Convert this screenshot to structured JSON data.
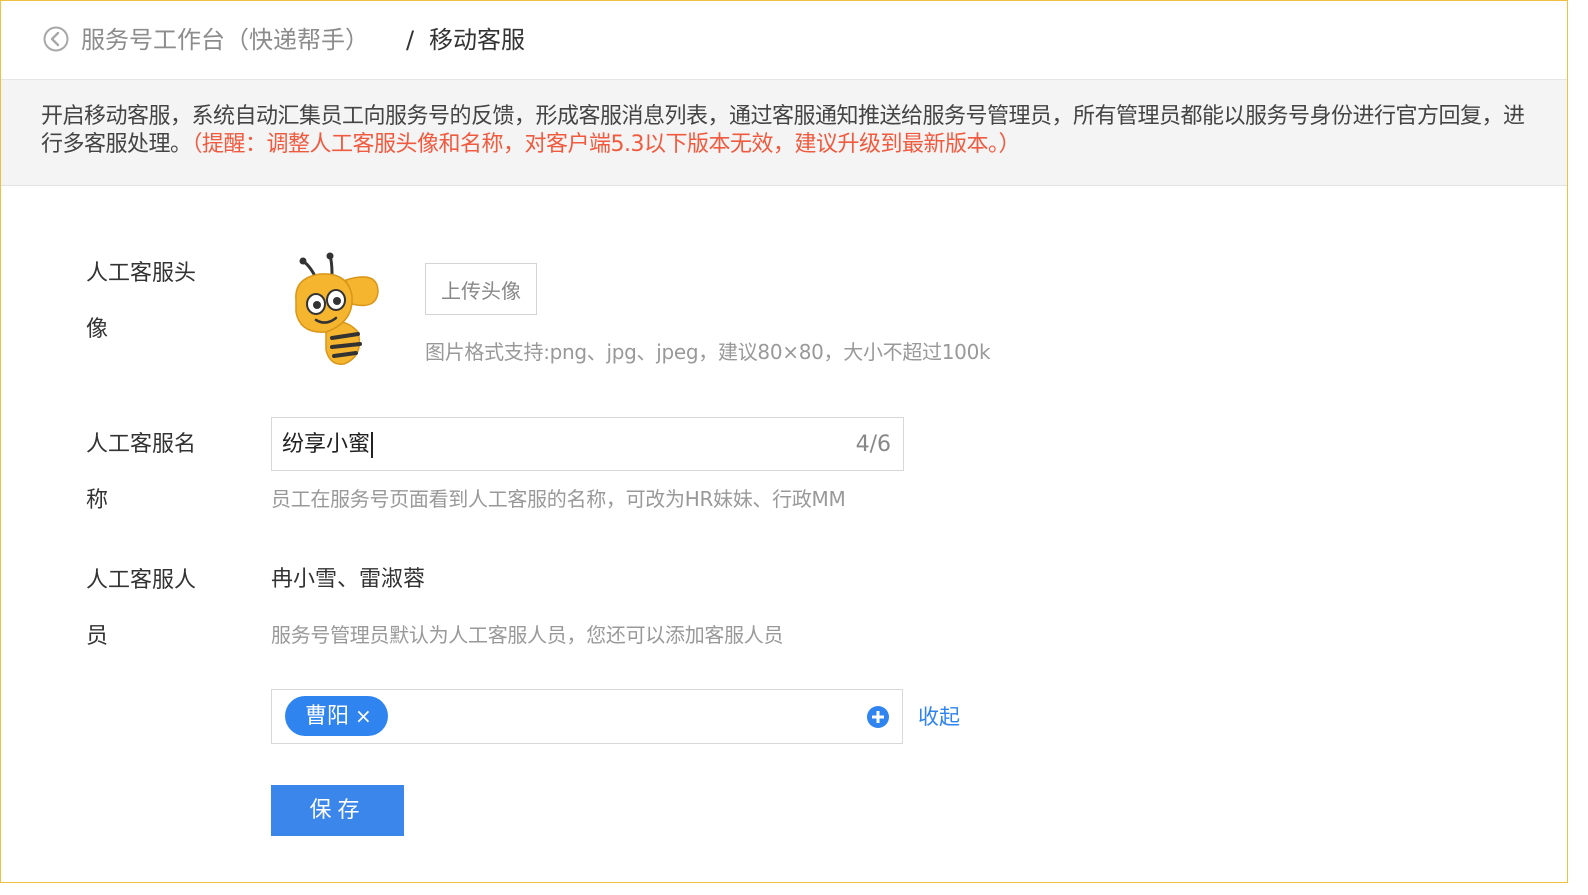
{
  "header": {
    "parent": "服务号工作台（快递帮手）",
    "separator": "/",
    "current": "移动客服"
  },
  "notice": {
    "text": "开启移动客服，系统自动汇集员工向服务号的反馈，形成客服消息列表，通过客服通知推送给服务号管理员，所有管理员都能以服务号身份进行官方回复，进行多客服处理。",
    "warning": "（提醒：调整人工客服头像和名称，对客户端5.3以下版本无效，建议升级到最新版本。）"
  },
  "avatar_section": {
    "label_line1": "人工客服头",
    "label_line2": "像",
    "upload_label": "上传头像",
    "hint": "图片格式支持:png、jpg、jpeg，建议80×80，大小不超过100k"
  },
  "name_section": {
    "label_line1": "人工客服名",
    "label_line2": "称",
    "value": "纷享小蜜",
    "counter": "4/6",
    "hint": "员工在服务号页面看到人工客服的名称，可改为HR妹妹、行政MM"
  },
  "staff_section": {
    "label_line1": "人工客服人",
    "label_line2": "员",
    "names": "冉小雪、雷淑蓉",
    "hint": "服务号管理员默认为人工客服人员，您还可以添加客服人员",
    "tags": [
      "曹阳"
    ],
    "tag_remove": "×",
    "collapse_label": "收起"
  },
  "save_label": "保存",
  "colors": {
    "accent": "#2f84f0",
    "warning": "#f05a3f",
    "frame_border": "#f0c040",
    "mascot": "#f5b52e"
  },
  "icons": {
    "back": "circle-chevron-left-icon",
    "add": "plus-circle-icon",
    "avatar": "bee-mascot"
  }
}
